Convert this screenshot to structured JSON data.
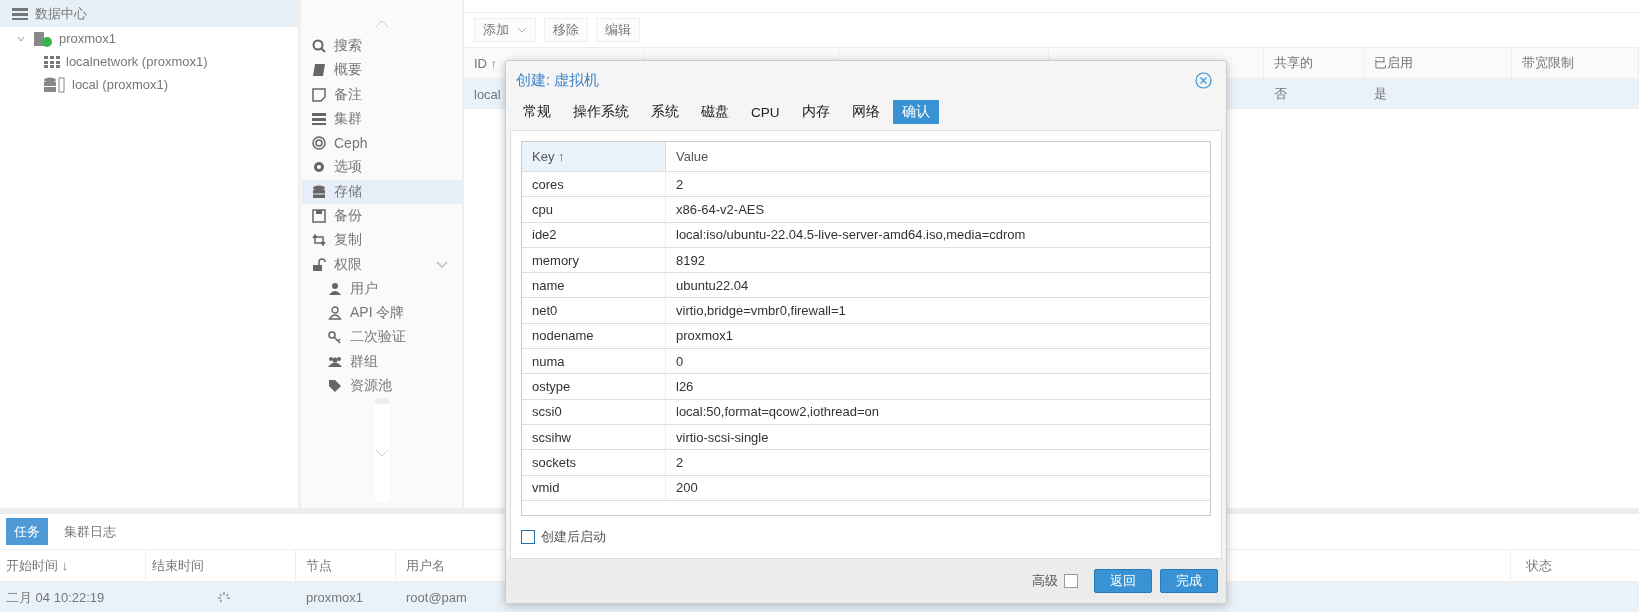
{
  "tree": [
    {
      "label": "数据中心",
      "selected": true,
      "children": [
        {
          "label": "proxmox1",
          "expanded": true,
          "children": [
            {
              "label": "localnetwork (proxmox1)",
              "kind": "network"
            },
            {
              "label": "local (proxmox1)",
              "kind": "storage"
            }
          ]
        }
      ]
    }
  ],
  "nav": [
    {
      "label": "搜索",
      "selected": false
    },
    {
      "label": "概要",
      "selected": false
    },
    {
      "label": "备注",
      "selected": false
    },
    {
      "label": "集群",
      "selected": false
    },
    {
      "label": "Ceph",
      "selected": false
    },
    {
      "label": "选项",
      "selected": false
    },
    {
      "label": "存储",
      "selected": true
    },
    {
      "label": "备份",
      "selected": false
    },
    {
      "label": "复制",
      "selected": false
    },
    {
      "label": "权限",
      "selected": false,
      "expanded": true,
      "children": [
        {
          "label": "用户",
          "selected": false
        },
        {
          "label": "API 令牌",
          "selected": false
        },
        {
          "label": "二次验证",
          "selected": false
        },
        {
          "label": "群组",
          "selected": false
        },
        {
          "label": "资源池",
          "selected": false
        }
      ]
    }
  ],
  "toolbar": [
    {
      "label": "添加",
      "kind": "menu"
    },
    {
      "label": "移除",
      "kind": "plain"
    },
    {
      "label": "编辑",
      "kind": "plain"
    }
  ],
  "storage_table": {
    "columns": [
      "ID ↑",
      "共享的",
      "已启用",
      "带宽限制"
    ],
    "rows": [
      {
        "id": "local",
        "shared": "否",
        "enabled": "是",
        "selected": true
      }
    ]
  },
  "dialog": {
    "title": "创建: 虚拟机",
    "tabs": [
      {
        "label": "常规",
        "selected": false
      },
      {
        "label": "操作系统",
        "selected": false
      },
      {
        "label": "系统",
        "selected": false
      },
      {
        "label": "磁盘",
        "selected": false
      },
      {
        "label": "CPU",
        "selected": false
      },
      {
        "label": "内存",
        "selected": false
      },
      {
        "label": "网络",
        "selected": false
      },
      {
        "label": "确认",
        "selected": true
      }
    ],
    "columns": [
      "Key ↑",
      "Value"
    ],
    "rows": [
      {
        "key": "cores",
        "value": "2"
      },
      {
        "key": "cpu",
        "value": "x86-64-v2-AES"
      },
      {
        "key": "ide2",
        "value": "local:iso/ubuntu-22.04.5-live-server-amd64.iso,media=cdrom"
      },
      {
        "key": "memory",
        "value": "8192"
      },
      {
        "key": "name",
        "value": "ubuntu22.04"
      },
      {
        "key": "net0",
        "value": "virtio,bridge=vmbr0,firewall=1"
      },
      {
        "key": "nodename",
        "value": "proxmox1"
      },
      {
        "key": "numa",
        "value": "0"
      },
      {
        "key": "ostype",
        "value": "l26"
      },
      {
        "key": "scsi0",
        "value": "local:50,format=qcow2,iothread=on"
      },
      {
        "key": "scsihw",
        "value": "virtio-scsi-single"
      },
      {
        "key": "sockets",
        "value": "2"
      },
      {
        "key": "vmid",
        "value": "200"
      }
    ],
    "start_after_create": {
      "label": "创建后启动",
      "checked": false
    },
    "advanced": {
      "label": "高级",
      "checked": false
    },
    "buttons": [
      "返回",
      "完成"
    ]
  },
  "tasks": {
    "tabs": [
      {
        "label": "任务",
        "selected": true
      },
      {
        "label": "集群日志",
        "selected": false
      }
    ],
    "columns": [
      "开始时间 ↓",
      "结束时间",
      "节点",
      "用户名",
      "状态"
    ],
    "rows": [
      {
        "start": "二月 04 10:22:19",
        "running": true,
        "node": "proxmox1",
        "user": "root@pam",
        "selected": true
      }
    ]
  }
}
